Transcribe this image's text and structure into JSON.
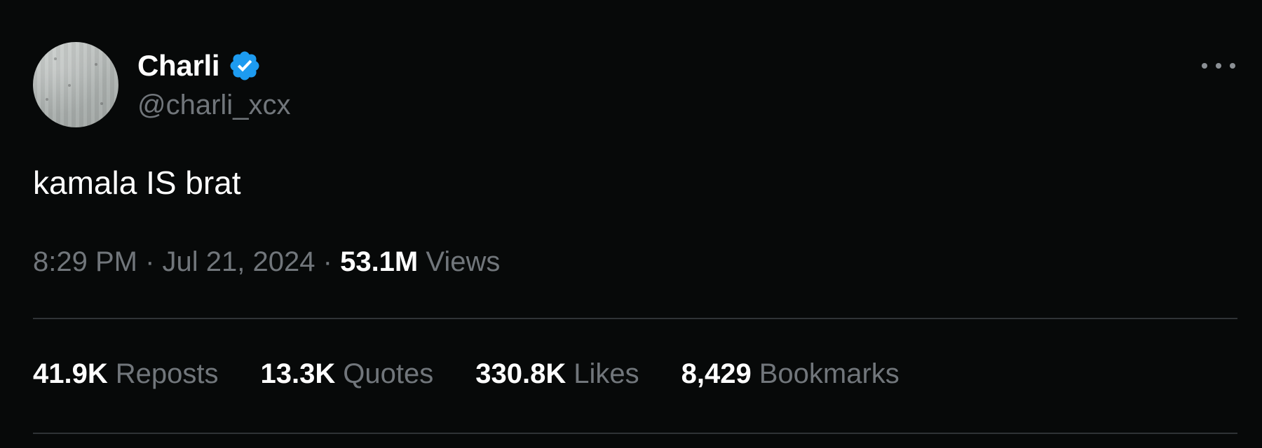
{
  "author": {
    "display_name": "Charli",
    "handle": "@charli_xcx",
    "verified": true,
    "verified_badge_color": "#1d9bf0"
  },
  "tweet": {
    "text": "kamala IS brat"
  },
  "meta": {
    "time": "8:29 PM",
    "separator": "·",
    "date": "Jul 21, 2024",
    "views_count": "53.1M",
    "views_label": "Views"
  },
  "stats": [
    {
      "count": "41.9K",
      "label": "Reposts"
    },
    {
      "count": "13.3K",
      "label": "Quotes"
    },
    {
      "count": "330.8K",
      "label": "Likes"
    },
    {
      "count": "8,429",
      "label": "Bookmarks"
    }
  ],
  "icons": {
    "more": "more-options-icon",
    "verified": "verified-badge-icon"
  },
  "colors": {
    "background": "#070909",
    "primary_text": "#ffffff",
    "secondary_text": "#71767b",
    "divider": "#2f3336"
  }
}
